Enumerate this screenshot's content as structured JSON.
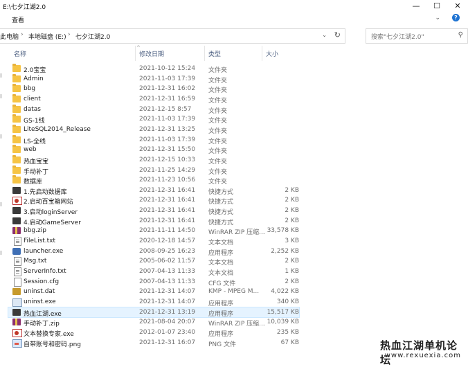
{
  "window": {
    "title": "E:\\七夕江湖2.0",
    "minimize": "—",
    "maximize": "☐",
    "close": "✕"
  },
  "ribbon": {
    "tab": "查看",
    "collapse": "⌄",
    "help": "?"
  },
  "address": {
    "crumbs": [
      "此电脑",
      "本地磁盘 (E:)",
      "七夕江湖2.0"
    ],
    "separator": "›",
    "dropdown": "⌄",
    "refresh": "↻"
  },
  "search": {
    "placeholder": "搜索\"七夕江湖2.0\"",
    "icon": "⚲"
  },
  "columns": {
    "name": "名称",
    "date": "修改日期",
    "type": "类型",
    "size": "大小",
    "sort": "^"
  },
  "files": [
    {
      "name": "2.0宝宝",
      "date": "2021-10-12 15:24",
      "type": "文件夹",
      "size": "",
      "icon": "folder"
    },
    {
      "name": "Admin",
      "date": "2021-11-03 17:39",
      "type": "文件夹",
      "size": "",
      "icon": "folder"
    },
    {
      "name": "bbg",
      "date": "2021-12-31 16:02",
      "type": "文件夹",
      "size": "",
      "icon": "folder"
    },
    {
      "name": "client",
      "date": "2021-12-31 16:59",
      "type": "文件夹",
      "size": "",
      "icon": "folder"
    },
    {
      "name": "datas",
      "date": "2021-12-15 8:57",
      "type": "文件夹",
      "size": "",
      "icon": "folder"
    },
    {
      "name": "GS-1线",
      "date": "2021-11-03 17:39",
      "type": "文件夹",
      "size": "",
      "icon": "folder"
    },
    {
      "name": "LiteSQL2014_Release",
      "date": "2021-12-31 13:25",
      "type": "文件夹",
      "size": "",
      "icon": "folder"
    },
    {
      "name": "LS-全线",
      "date": "2021-11-03 17:39",
      "type": "文件夹",
      "size": "",
      "icon": "folder"
    },
    {
      "name": "web",
      "date": "2021-12-31 15:50",
      "type": "文件夹",
      "size": "",
      "icon": "folder"
    },
    {
      "name": "热血宝宝",
      "date": "2021-12-15 10:33",
      "type": "文件夹",
      "size": "",
      "icon": "folder"
    },
    {
      "name": "手动补丁",
      "date": "2021-11-25 14:29",
      "type": "文件夹",
      "size": "",
      "icon": "folder"
    },
    {
      "name": "数据库",
      "date": "2021-11-23 10:56",
      "type": "文件夹",
      "size": "",
      "icon": "folder"
    },
    {
      "name": "1.先启动数据库",
      "date": "2021-12-31 16:41",
      "type": "快捷方式",
      "size": "2 KB",
      "icon": "app-dark"
    },
    {
      "name": "2.启动百宝箱网站",
      "date": "2021-12-31 16:41",
      "type": "快捷方式",
      "size": "2 KB",
      "icon": "app-red"
    },
    {
      "name": "3.启动loginServer",
      "date": "2021-12-31 16:41",
      "type": "快捷方式",
      "size": "2 KB",
      "icon": "app-dark"
    },
    {
      "name": "4.启动GameServer",
      "date": "2021-12-31 16:41",
      "type": "快捷方式",
      "size": "2 KB",
      "icon": "app-dark"
    },
    {
      "name": "bbg.zip",
      "date": "2021-11-11 14:50",
      "type": "WinRAR ZIP 压缩...",
      "size": "33,578 KB",
      "icon": "zip"
    },
    {
      "name": "FileList.txt",
      "date": "2020-12-18 14:57",
      "type": "文本文档",
      "size": "3 KB",
      "icon": "file-text"
    },
    {
      "name": "launcher.exe",
      "date": "2008-09-25 16:23",
      "type": "应用程序",
      "size": "2,252 KB",
      "icon": "exe-blue"
    },
    {
      "name": "Msg.txt",
      "date": "2005-06-02 11:57",
      "type": "文本文档",
      "size": "2 KB",
      "icon": "file-text"
    },
    {
      "name": "ServerInfo.txt",
      "date": "2007-04-13 11:33",
      "type": "文本文档",
      "size": "1 KB",
      "icon": "file-text"
    },
    {
      "name": "Session.cfg",
      "date": "2007-04-13 11:33",
      "type": "CFG 文件",
      "size": "2 KB",
      "icon": "file-generic"
    },
    {
      "name": "uninst.dat",
      "date": "2021-12-31 14:07",
      "type": "KMP - MPEG M...",
      "size": "4,022 KB",
      "icon": "exe-gold"
    },
    {
      "name": "uninst.exe",
      "date": "2021-12-31 14:07",
      "type": "应用程序",
      "size": "340 KB",
      "icon": "exe-ghost"
    },
    {
      "name": "热血江湖.exe",
      "date": "2021-12-31 13:19",
      "type": "应用程序",
      "size": "15,517 KB",
      "icon": "app-dark"
    },
    {
      "name": "手动补丁.zip",
      "date": "2021-08-04 20:07",
      "type": "WinRAR ZIP 压缩...",
      "size": "10,039 KB",
      "icon": "zip"
    },
    {
      "name": "文本替换专家.exe",
      "date": "2012-01-07 23:40",
      "type": "应用程序",
      "size": "235 KB",
      "icon": "app-red"
    },
    {
      "name": "自带账号和密码.png",
      "date": "2021-12-31 16:07",
      "type": "PNG 文件",
      "size": "67 KB",
      "icon": "img"
    }
  ],
  "selected_row": "热血江湖.exe",
  "watermark": {
    "title": "热血江湖单机论坛",
    "url": "www.rexuexia.com"
  }
}
